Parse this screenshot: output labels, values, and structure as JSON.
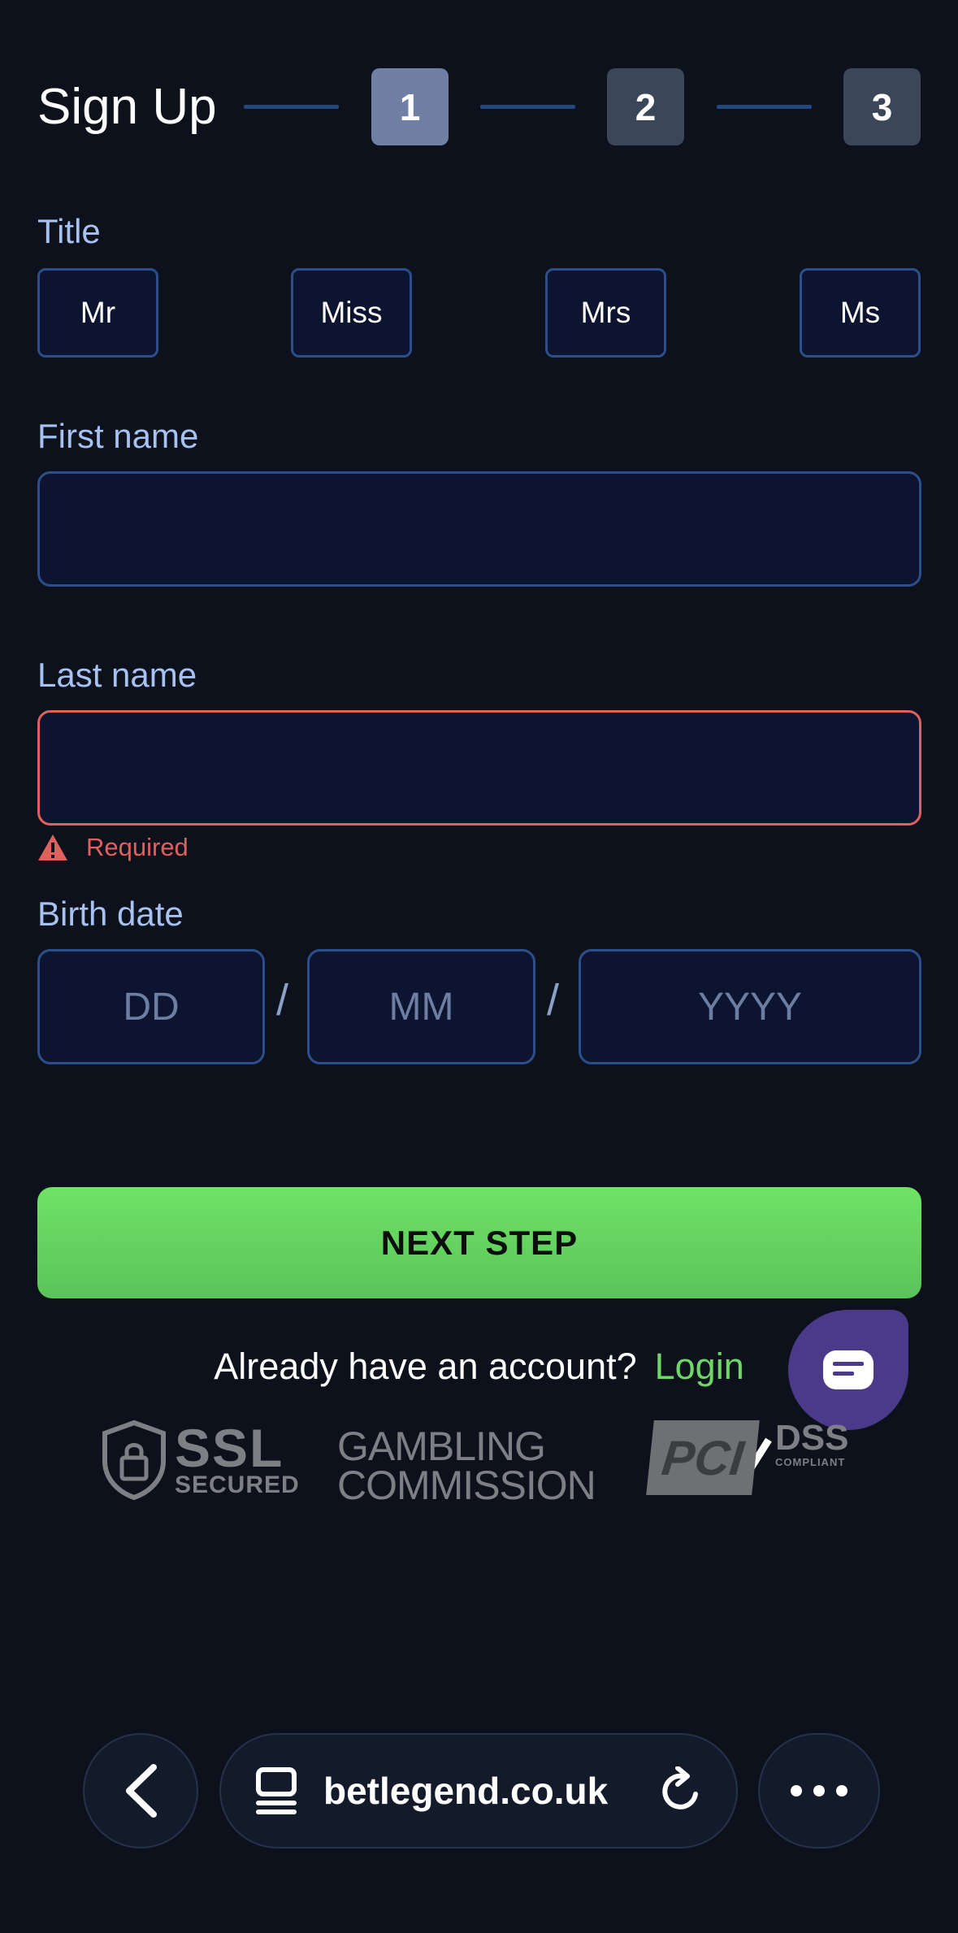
{
  "header": {
    "title": "Sign Up",
    "steps": [
      {
        "label": "1",
        "active": true
      },
      {
        "label": "2",
        "active": false
      },
      {
        "label": "3",
        "active": false
      }
    ]
  },
  "form": {
    "title_label": "Title",
    "title_options": [
      "Mr",
      "Miss",
      "Mrs",
      "Ms"
    ],
    "first_name_label": "First name",
    "first_name_value": "",
    "last_name_label": "Last name",
    "last_name_value": "",
    "last_name_error": "Required",
    "birth_date_label": "Birth date",
    "birth_day_placeholder": "DD",
    "birth_month_placeholder": "MM",
    "birth_year_placeholder": "YYYY",
    "date_separator": "/",
    "next_label": "NEXT STEP"
  },
  "login": {
    "question": "Already have an account?",
    "link_label": "Login"
  },
  "trust": {
    "ssl_main": "SSL",
    "ssl_sub": "SECURED",
    "gambling_line1": "GAMBLING",
    "gambling_line2": "COMMISSION",
    "pci_main": "PCI",
    "pci_dss": "DSS",
    "pci_compliant": "COMPLIANT"
  },
  "browser": {
    "url": "betlegend.co.uk"
  },
  "colors": {
    "background": "#0c111c",
    "accent_green": "#6fd766",
    "error_red": "#e0605e",
    "label_blue": "#a7c1f0",
    "input_border": "#2c4f8c",
    "chat_purple": "#4b3a8a"
  }
}
